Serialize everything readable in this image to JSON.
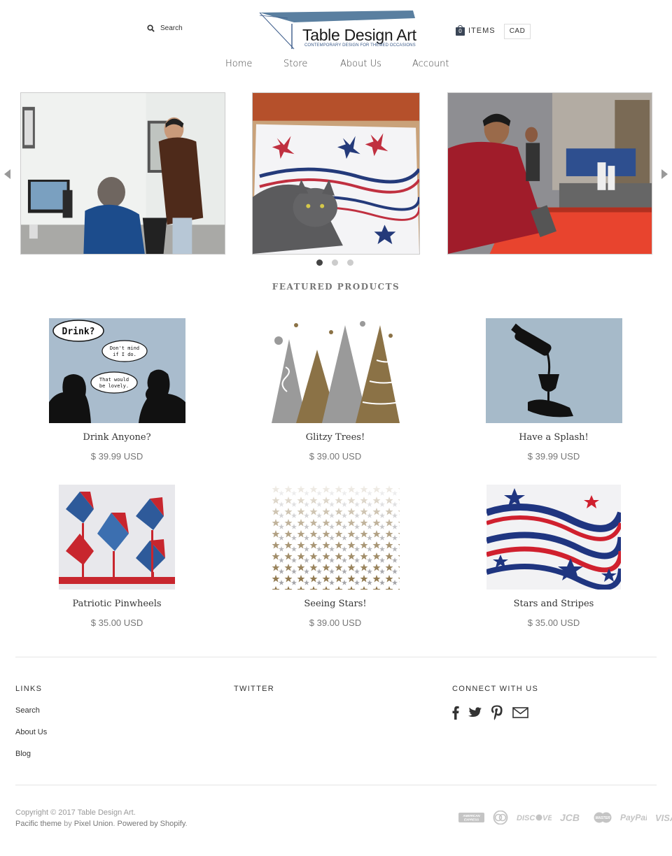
{
  "header": {
    "search_label": "Search",
    "logo_title": "Table Design Art",
    "logo_tagline": "CONTEMPORARY DESIGN FOR THEMED OCCASIONS",
    "cart_count": "0",
    "cart_label": "ITEMS",
    "currency": "CAD"
  },
  "nav": {
    "items": [
      {
        "label": "Home"
      },
      {
        "label": "Store"
      },
      {
        "label": "About Us"
      },
      {
        "label": "Account"
      }
    ]
  },
  "slideshow": {
    "slide_count": 3,
    "active_slide": 1
  },
  "featured": {
    "title": "FEATURED PRODUCTS",
    "products": [
      {
        "name": "Drink Anyone?",
        "price": "$ 39.99 USD",
        "bubbles": [
          "Drink?",
          "Don't mind",
          "if I do.",
          "That would",
          "be lovely."
        ]
      },
      {
        "name": "Glitzy Trees!",
        "price": "$ 39.00 USD"
      },
      {
        "name": "Have a Splash!",
        "price": "$ 39.99 USD"
      },
      {
        "name": "Patriotic Pinwheels",
        "price": "$ 35.00 USD"
      },
      {
        "name": "Seeing Stars!",
        "price": "$ 39.00 USD"
      },
      {
        "name": "Stars and Stripes",
        "price": "$ 35.00 USD"
      }
    ]
  },
  "footer": {
    "links_title": "LINKS",
    "links": [
      {
        "label": "Search"
      },
      {
        "label": "About Us"
      },
      {
        "label": "Blog"
      }
    ],
    "twitter_title": "TWITTER",
    "connect_title": "CONNECT WITH US",
    "social_icons": [
      "facebook-icon",
      "twitter-icon",
      "pinterest-icon",
      "email-icon"
    ],
    "copyright": "Copyright © 2017 Table Design Art.",
    "theme_link": "Pacific theme",
    "by": " by ",
    "author_link": "Pixel Union",
    "powered_prefix": ". ",
    "powered_link": "Powered by Shopify",
    "powered_suffix": ".",
    "payments": [
      "AMERICAN EXPRESS",
      "DINERS",
      "DISCOVER",
      "JCB",
      "MASTER",
      "PayPal",
      "VISA"
    ]
  },
  "colors": {
    "accent": "#3b5b8a",
    "text": "#333333",
    "muted": "#777777"
  }
}
